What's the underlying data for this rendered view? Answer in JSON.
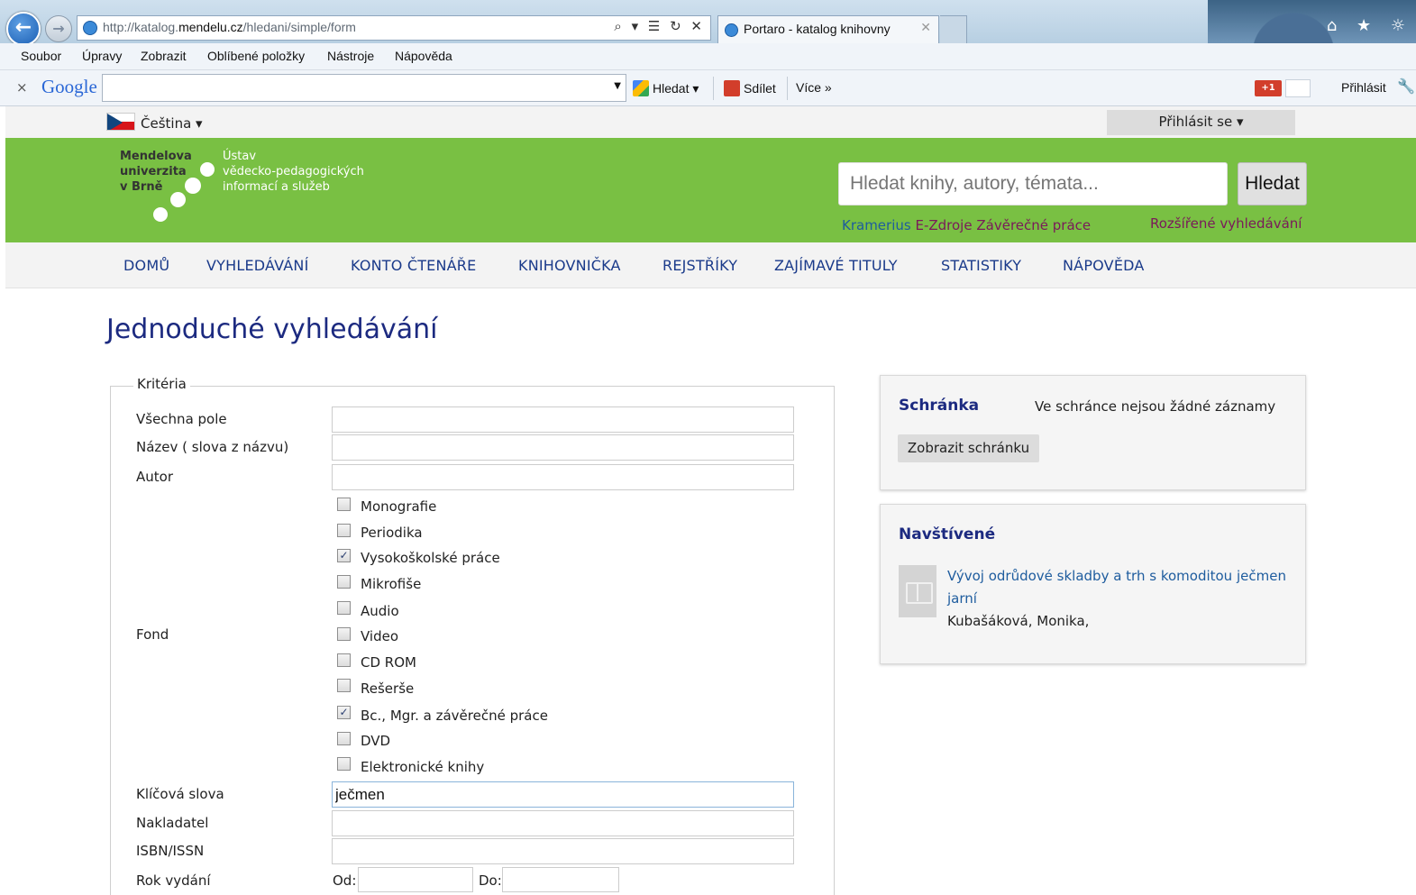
{
  "browser": {
    "url_prefix": "http://katalog.",
    "url_domain": "mendelu.cz",
    "url_path": "/hledani/simple/form",
    "address_tools": "⌕ ▾ ☰ ↻ ✕",
    "tab_title": "Portaro - katalog knihovny",
    "tab_close": "✕",
    "chrome_icons": "⌂ ★ ☼",
    "menu": [
      "Soubor",
      "Úpravy",
      "Zobrazit",
      "Oblíbené položky",
      "Nástroje",
      "Nápověda"
    ],
    "google": {
      "close": "×",
      "logo": "Google",
      "search_value": "",
      "search_btn": "Hledat ▾",
      "share_btn": "Sdílet",
      "more_btn": "Více »",
      "plus_one": "+1",
      "signin": "Přihlásit",
      "wrench": "🔧"
    }
  },
  "topstrip": {
    "language": "Čeština ▾",
    "login": "Přihlásit se ▾"
  },
  "header": {
    "logo_left": [
      "Mendelova",
      "univerzita",
      "v Brně"
    ],
    "logo_right": [
      "Ústav",
      "vědecko-pedagogických",
      "informací a služeb"
    ],
    "search_placeholder": "Hledat knihy, autory, témata...",
    "search_button": "Hledat",
    "link_kramerius": "Kramerius",
    "link_ezdroje": "E-Zdroje",
    "link_zaverecne": "Závěrečné práce",
    "link_advanced": "Rozšířené vyhledávání"
  },
  "nav": [
    "DOMŮ",
    "VYHLEDÁVÁNÍ",
    "KONTO ČTENÁŘE",
    "KNIHOVNIČKA",
    "REJSTŘÍKY",
    "ZAJÍMAVÉ TITULY",
    "STATISTIKY",
    "NÁPOVĚDA"
  ],
  "page_title": "Jednoduché vyhledávání",
  "form": {
    "legend": "Kritéria",
    "all_fields_label": "Všechna pole",
    "all_fields_value": "",
    "title_label": "Název ( slova z názvu)",
    "title_value": "",
    "author_label": "Autor",
    "author_value": "",
    "fond_label": "Fond",
    "fond_options": [
      {
        "label": "Monografie",
        "checked": false
      },
      {
        "label": "Periodika",
        "checked": false
      },
      {
        "label": "Vysokoškolské práce",
        "checked": true
      },
      {
        "label": "Mikrofiše",
        "checked": false
      },
      {
        "label": "Audio",
        "checked": false
      },
      {
        "label": "Video",
        "checked": false
      },
      {
        "label": "CD ROM",
        "checked": false
      },
      {
        "label": "Rešerše",
        "checked": false
      },
      {
        "label": "Bc., Mgr. a závěrečné práce",
        "checked": true
      },
      {
        "label": "DVD",
        "checked": false
      },
      {
        "label": "Elektronické knihy",
        "checked": false
      }
    ],
    "keywords_label": "Klíčová slova",
    "keywords_value": "ječmen",
    "publisher_label": "Nakladatel",
    "publisher_value": "",
    "isbn_label": "ISBN/ISSN",
    "isbn_value": "",
    "year_label": "Rok vydání",
    "year_from_label": "Od:",
    "year_to_label": "Do:"
  },
  "clipboard": {
    "title": "Schránka",
    "note": "Ve schránce nejsou žádné záznamy",
    "button": "Zobrazit schránku"
  },
  "visited": {
    "title": "Navštívené",
    "item_title": "Vývoj odrůdové skladby a trh s komoditou ječmen jarní",
    "item_author": "Kubašáková, Monika,"
  }
}
